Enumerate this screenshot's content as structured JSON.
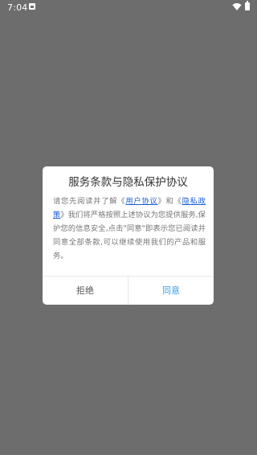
{
  "status_bar": {
    "time": "7:04",
    "icons": [
      "notification-icon",
      "wifi-icon",
      "battery-icon"
    ]
  },
  "dialog": {
    "title": "服务条款与隐私保护协议",
    "body": {
      "part1": "请您先阅读并了解《",
      "link_user_agreement": "用户协议",
      "part2": "》和《",
      "link_privacy_policy": "隐私政策",
      "part3": "》我们将严格按照上述协议为您提供服务,保护您的信息安全,点击\"同意\"即表示您已阅读并同意全部条款,可以继续使用我们的产品和服务。"
    },
    "reject_label": "拒绝",
    "agree_label": "同意"
  },
  "colors": {
    "overlay": "#6d6d6d",
    "link": "#1a5fd6",
    "agree": "#3aa0e8"
  }
}
